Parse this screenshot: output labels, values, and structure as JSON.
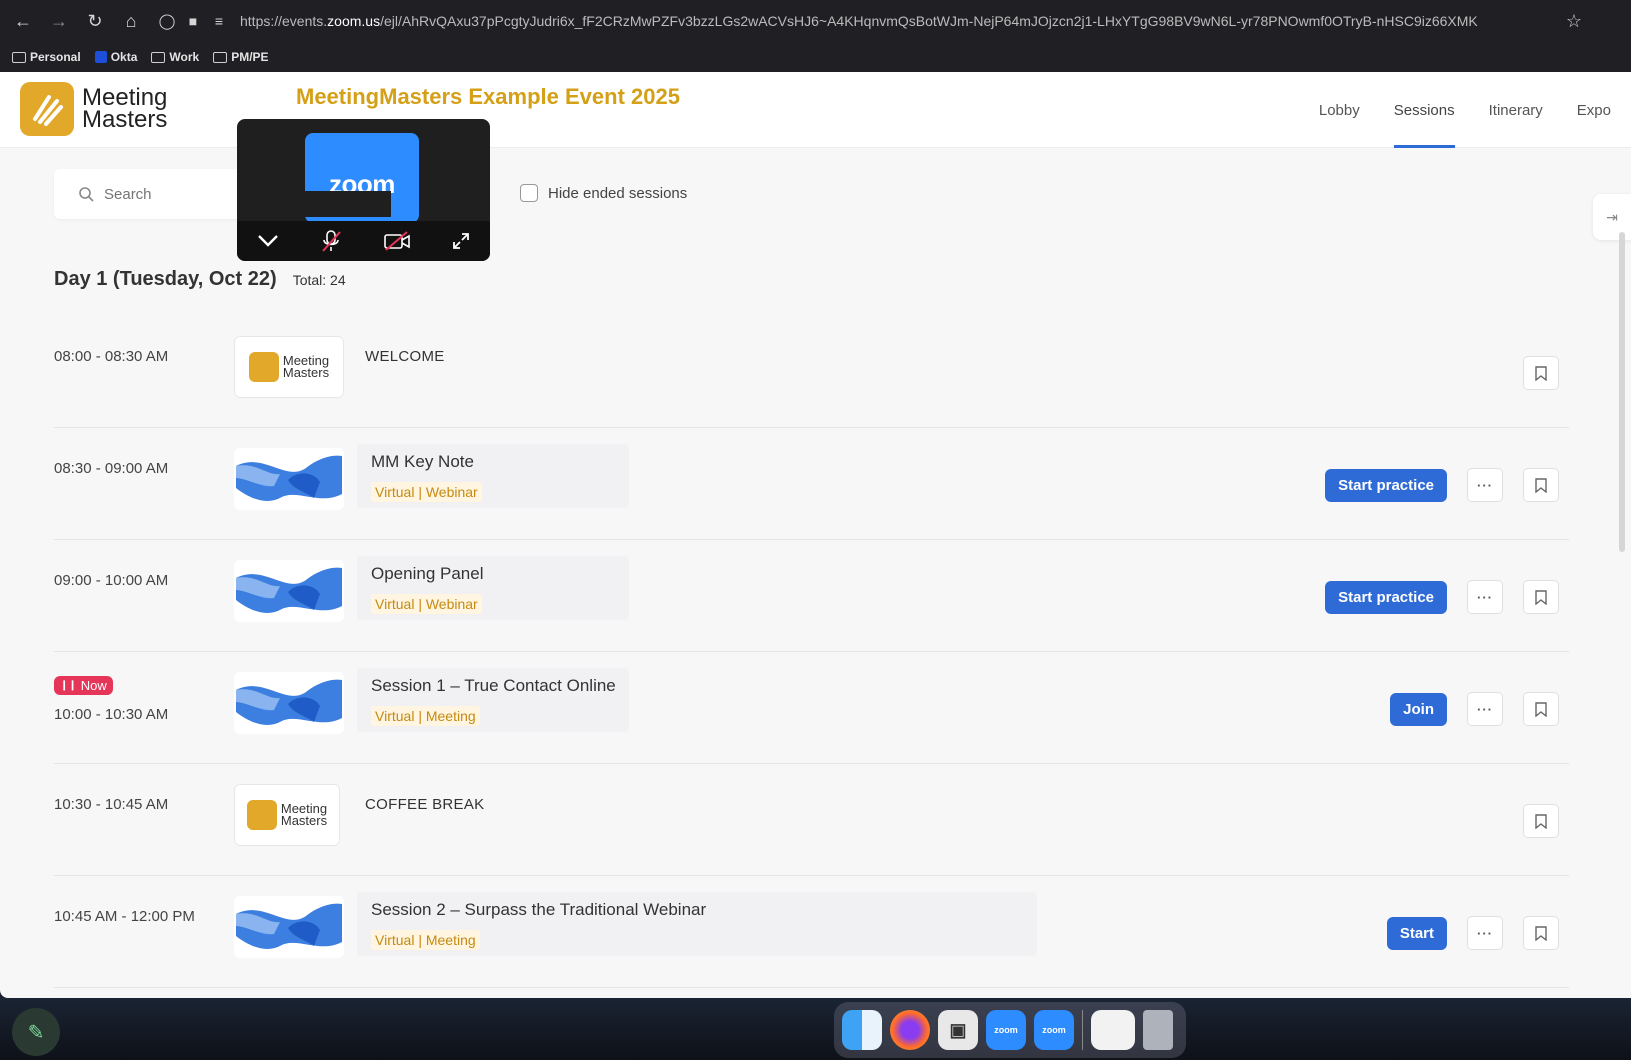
{
  "browser": {
    "url_prefix": "https://events.",
    "url_domain": "zoom.us",
    "url_rest": "/ejl/AhRvQAxu37pPcgtyJudri6x_fF2CRzMwPZFv3bzzLGs2wACVsHJ6~A4KHqnvmQsBotWJm-NejP64mJOjzcn2j1-LHxYTgG98BV9wN6L-yr78PNOwmf0OTryB-nHSC9iz66XMK",
    "bookmarks": [
      "Personal",
      "Okta",
      "Work",
      "PM/PE"
    ]
  },
  "header": {
    "logo_line1": "Meeting",
    "logo_line2": "Masters",
    "event_title": "MeetingMasters Example Event 2025",
    "nav": [
      "Lobby",
      "Sessions",
      "Itinerary",
      "Expo"
    ],
    "active_nav": "Sessions"
  },
  "filters": {
    "search_placeholder": "Search",
    "hide_ended_label": "Hide ended sessions"
  },
  "zoom_widget": {
    "label": "zoom"
  },
  "day": {
    "title": "Day 1  (Tuesday, Oct 22)",
    "total": "Total: 24"
  },
  "sessions": [
    {
      "time": "08:00 - 08:30 AM",
      "title": "WELCOME",
      "thumb": "logo"
    },
    {
      "time": "08:30 - 09:00 AM",
      "title": "MM Key Note",
      "tag": "Virtual | Webinar",
      "thumb": "zoom",
      "action": "Start practice"
    },
    {
      "time": "09:00 - 10:00 AM",
      "title": "Opening Panel",
      "tag": "Virtual | Webinar",
      "thumb": "zoom",
      "action": "Start practice"
    },
    {
      "time": "10:00 - 10:30 AM",
      "title": "Session 1 – True Contact Online",
      "tag": "Virtual | Meeting",
      "thumb": "zoom",
      "action": "Join",
      "badge": "Now"
    },
    {
      "time": "10:30 - 10:45 AM",
      "title": "COFFEE BREAK",
      "thumb": "logo"
    },
    {
      "time": "10:45 AM - 12:00 PM",
      "title": "Session 2 – Surpass the Traditional Webinar",
      "tag": "Virtual | Meeting",
      "thumb": "zoom",
      "action": "Start"
    }
  ],
  "more_label": "···",
  "dock": {
    "apps": [
      "finder-icon",
      "firefox-icon",
      "screenshot-icon",
      "zoom",
      "zoom",
      "preview-icon",
      "trash-icon"
    ]
  },
  "colors": {
    "accent": "#2f6bd6",
    "brand": "#e2a82a",
    "title": "#d4a017",
    "now": "#e5365a"
  }
}
